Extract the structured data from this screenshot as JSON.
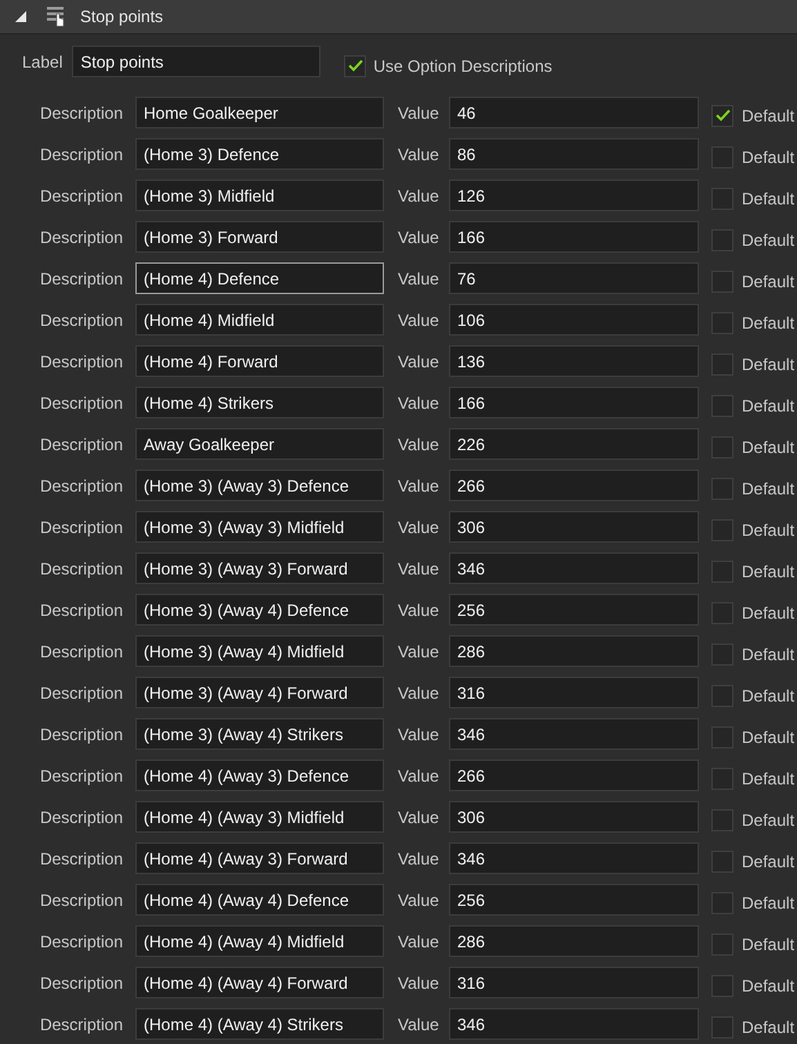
{
  "header": {
    "expanded": true,
    "title": "Stop points"
  },
  "label_field": {
    "label": "Label",
    "value": "Stop points"
  },
  "use_descriptions": {
    "label": "Use Option Descriptions",
    "checked": true
  },
  "options": [
    {
      "description_label": "Description",
      "description": "Home Goalkeeper",
      "value_label": "Value",
      "value": "46",
      "default_label": "Default",
      "default": true,
      "focused": false
    },
    {
      "description_label": "Description",
      "description": "(Home 3) Defence",
      "value_label": "Value",
      "value": "86",
      "default_label": "Default",
      "default": false,
      "focused": false
    },
    {
      "description_label": "Description",
      "description": "(Home 3) Midfield",
      "value_label": "Value",
      "value": "126",
      "default_label": "Default",
      "default": false,
      "focused": false
    },
    {
      "description_label": "Description",
      "description": "(Home 3) Forward",
      "value_label": "Value",
      "value": "166",
      "default_label": "Default",
      "default": false,
      "focused": false
    },
    {
      "description_label": "Description",
      "description": "(Home 4) Defence",
      "value_label": "Value",
      "value": "76",
      "default_label": "Default",
      "default": false,
      "focused": true
    },
    {
      "description_label": "Description",
      "description": "(Home 4) Midfield",
      "value_label": "Value",
      "value": "106",
      "default_label": "Default",
      "default": false,
      "focused": false
    },
    {
      "description_label": "Description",
      "description": "(Home 4) Forward",
      "value_label": "Value",
      "value": "136",
      "default_label": "Default",
      "default": false,
      "focused": false
    },
    {
      "description_label": "Description",
      "description": "(Home 4) Strikers",
      "value_label": "Value",
      "value": "166",
      "default_label": "Default",
      "default": false,
      "focused": false
    },
    {
      "description_label": "Description",
      "description": "Away Goalkeeper",
      "value_label": "Value",
      "value": "226",
      "default_label": "Default",
      "default": false,
      "focused": false
    },
    {
      "description_label": "Description",
      "description": "(Home 3) (Away 3) Defence",
      "value_label": "Value",
      "value": "266",
      "default_label": "Default",
      "default": false,
      "focused": false
    },
    {
      "description_label": "Description",
      "description": "(Home 3) (Away 3) Midfield",
      "value_label": "Value",
      "value": "306",
      "default_label": "Default",
      "default": false,
      "focused": false
    },
    {
      "description_label": "Description",
      "description": "(Home 3) (Away 3) Forward",
      "value_label": "Value",
      "value": "346",
      "default_label": "Default",
      "default": false,
      "focused": false
    },
    {
      "description_label": "Description",
      "description": "(Home 3) (Away 4) Defence",
      "value_label": "Value",
      "value": "256",
      "default_label": "Default",
      "default": false,
      "focused": false
    },
    {
      "description_label": "Description",
      "description": "(Home 3) (Away 4) Midfield",
      "value_label": "Value",
      "value": "286",
      "default_label": "Default",
      "default": false,
      "focused": false
    },
    {
      "description_label": "Description",
      "description": "(Home 3) (Away 4) Forward",
      "value_label": "Value",
      "value": "316",
      "default_label": "Default",
      "default": false,
      "focused": false
    },
    {
      "description_label": "Description",
      "description": "(Home 3) (Away 4) Strikers",
      "value_label": "Value",
      "value": "346",
      "default_label": "Default",
      "default": false,
      "focused": false
    },
    {
      "description_label": "Description",
      "description": "(Home 4) (Away 3) Defence",
      "value_label": "Value",
      "value": "266",
      "default_label": "Default",
      "default": false,
      "focused": false
    },
    {
      "description_label": "Description",
      "description": "(Home 4) (Away 3) Midfield",
      "value_label": "Value",
      "value": "306",
      "default_label": "Default",
      "default": false,
      "focused": false
    },
    {
      "description_label": "Description",
      "description": "(Home 4) (Away 3) Forward",
      "value_label": "Value",
      "value": "346",
      "default_label": "Default",
      "default": false,
      "focused": false
    },
    {
      "description_label": "Description",
      "description": "(Home 4) (Away 4) Defence",
      "value_label": "Value",
      "value": "256",
      "default_label": "Default",
      "default": false,
      "focused": false
    },
    {
      "description_label": "Description",
      "description": "(Home 4) (Away 4) Midfield",
      "value_label": "Value",
      "value": "286",
      "default_label": "Default",
      "default": false,
      "focused": false
    },
    {
      "description_label": "Description",
      "description": "(Home 4) (Away 4) Forward",
      "value_label": "Value",
      "value": "316",
      "default_label": "Default",
      "default": false,
      "focused": false
    },
    {
      "description_label": "Description",
      "description": "(Home 4) (Away 4) Strikers",
      "value_label": "Value",
      "value": "346",
      "default_label": "Default",
      "default": false,
      "focused": false
    }
  ]
}
